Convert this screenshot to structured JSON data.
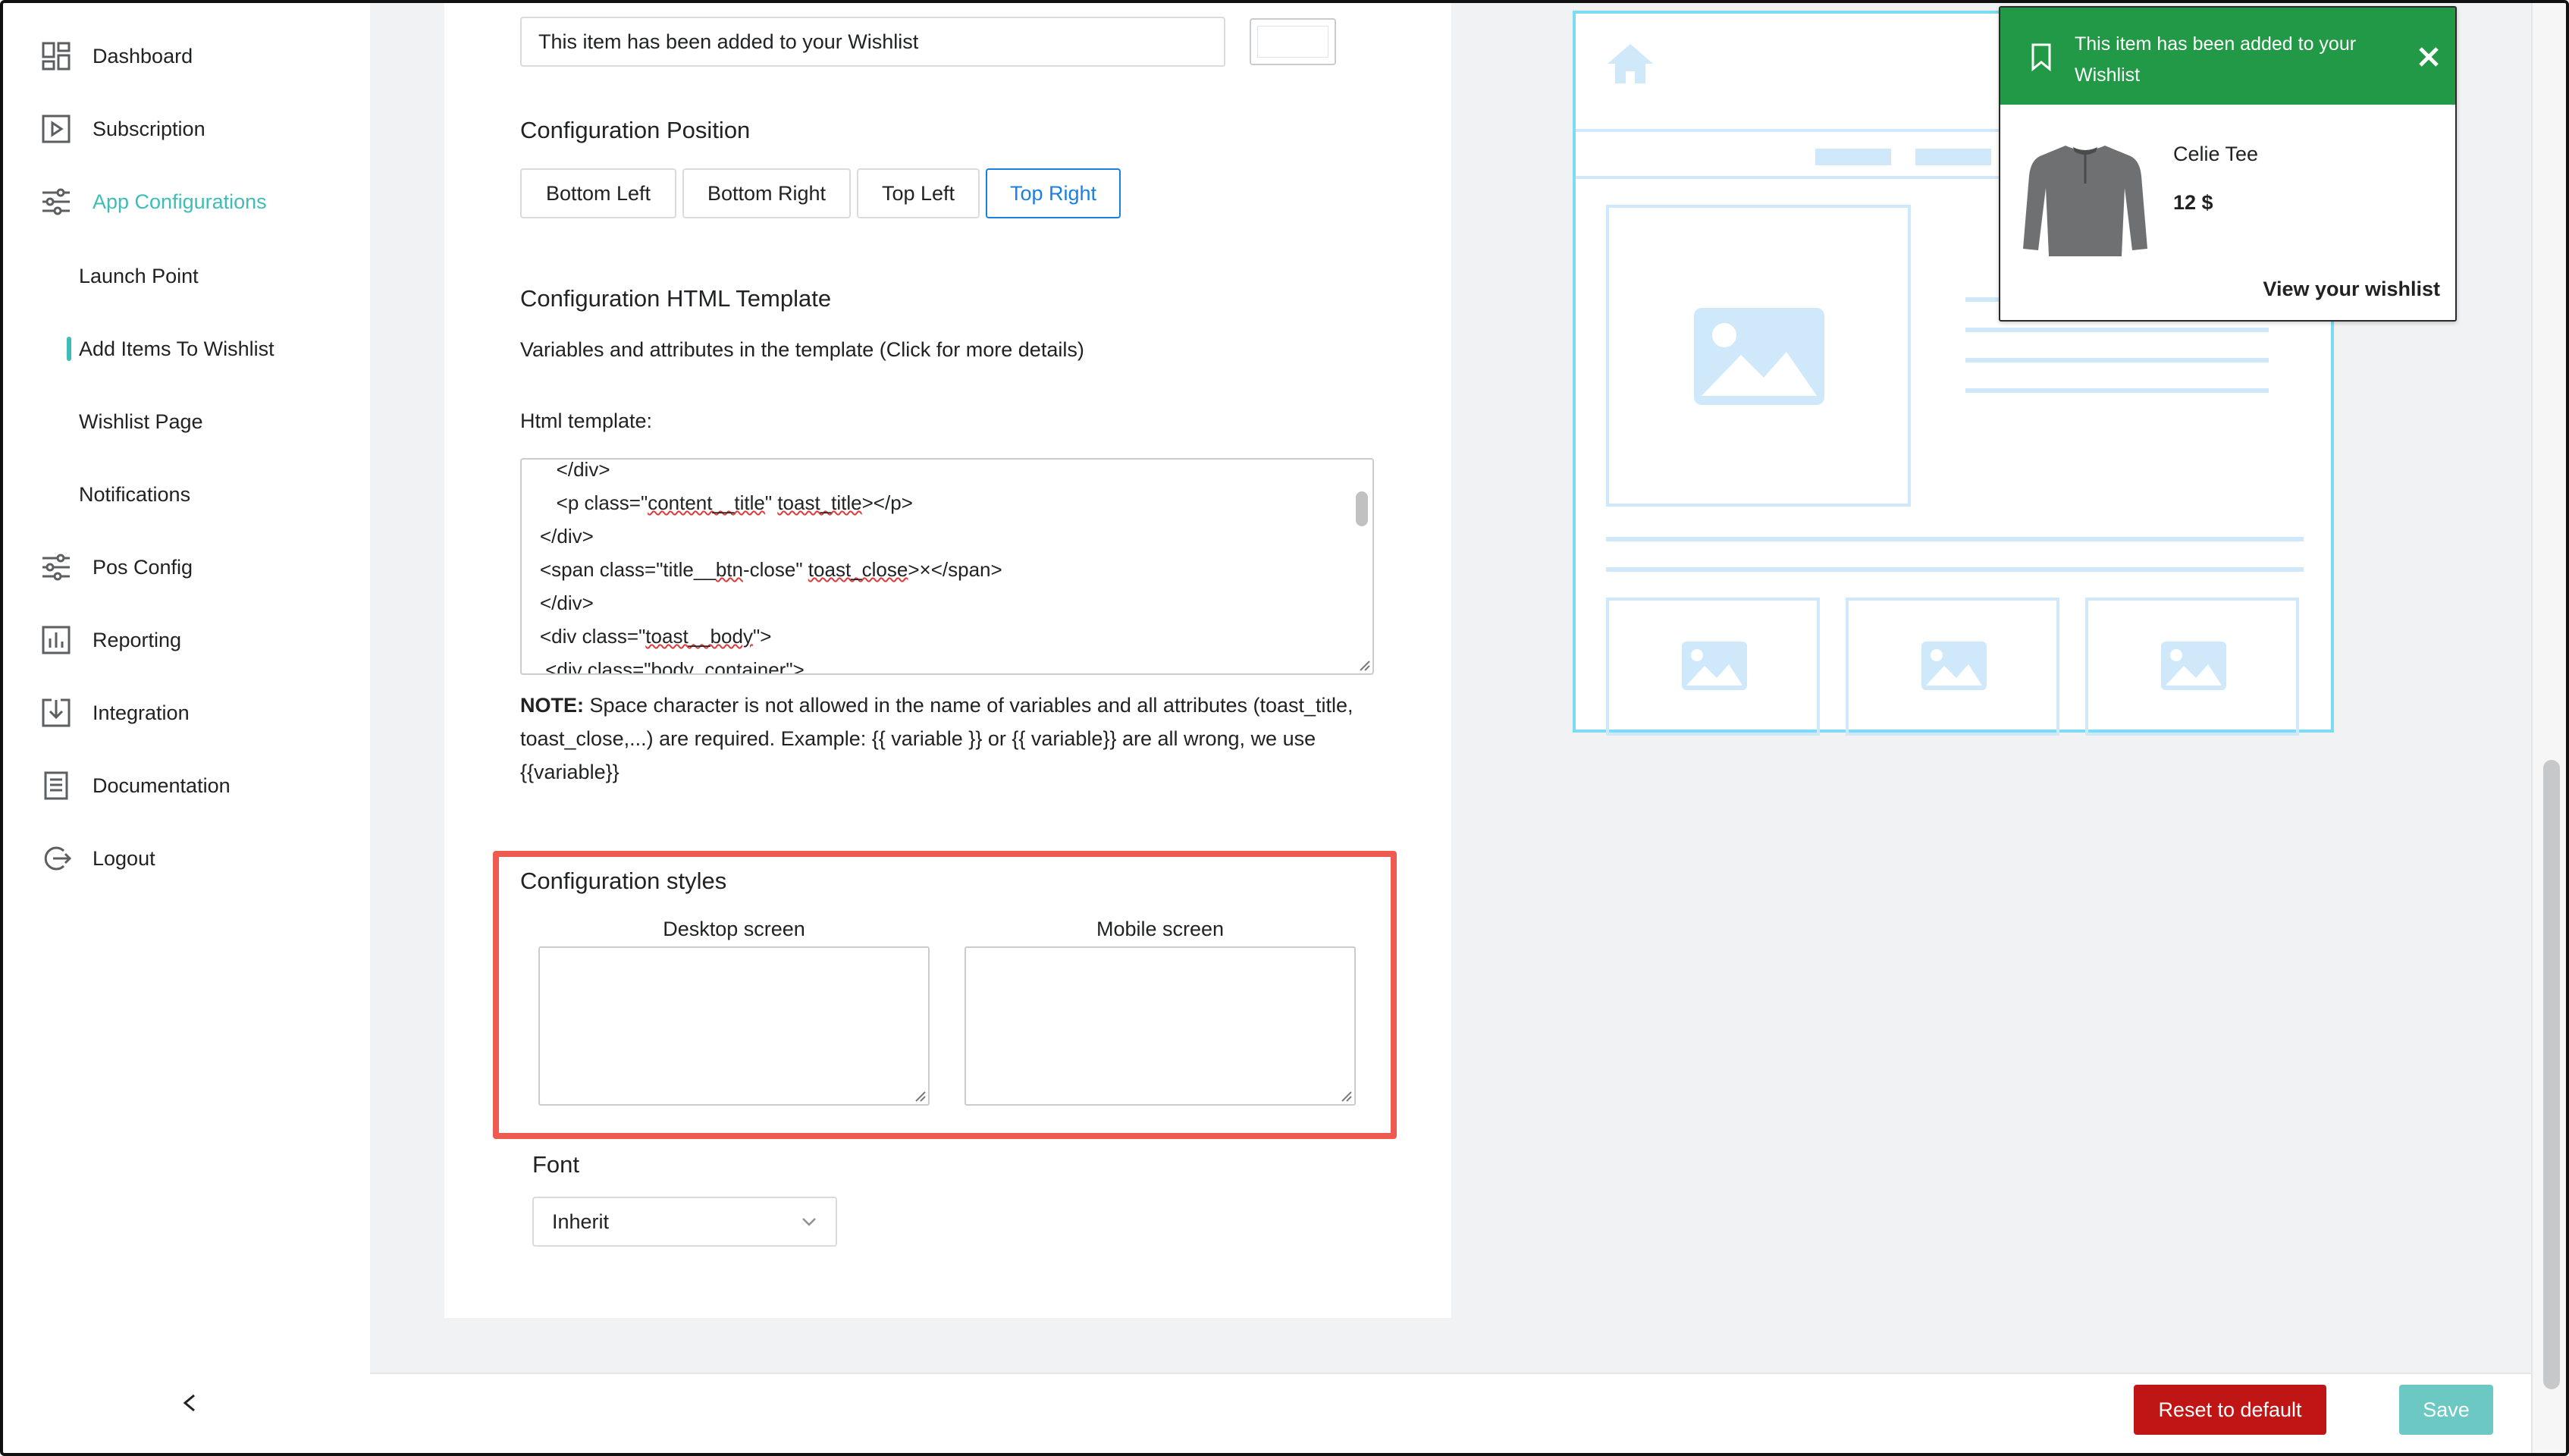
{
  "sidebar": {
    "items": [
      {
        "label": "Dashboard",
        "icon": "dashboard-icon"
      },
      {
        "label": "Subscription",
        "icon": "play-square-icon"
      },
      {
        "label": "App Configurations",
        "icon": "sliders-icon"
      },
      {
        "label": "Pos Config",
        "icon": "sliders-icon"
      },
      {
        "label": "Reporting",
        "icon": "bar-chart-icon"
      },
      {
        "label": "Integration",
        "icon": "download-box-icon"
      },
      {
        "label": "Documentation",
        "icon": "document-icon"
      },
      {
        "label": "Logout",
        "icon": "logout-icon"
      }
    ],
    "sub_items": [
      {
        "label": "Launch Point"
      },
      {
        "label": "Add Items To Wishlist"
      },
      {
        "label": "Wishlist Page"
      },
      {
        "label": "Notifications"
      }
    ],
    "collapse_glyph": "<"
  },
  "form": {
    "message_value": "This item has been added to your Wishlist",
    "position": {
      "title": "Configuration Position",
      "options": [
        "Bottom Left",
        "Bottom Right",
        "Top Left",
        "Top Right"
      ],
      "selected": "Top Right"
    },
    "template": {
      "title": "Configuration HTML Template",
      "description": "Variables and attributes in the template (Click for more details)",
      "field_label": "Html template:",
      "note_bold": "NOTE:",
      "note_text": " Space character is not allowed in the name of variables and all attributes (toast_title, toast_close,...) are required. Example: {{ variable }} or {{ variable}} are all wrong, we use {{variable}}"
    },
    "styles": {
      "title": "Configuration styles",
      "desktop_label": "Desktop screen",
      "mobile_label": "Mobile screen"
    },
    "font": {
      "label": "Font",
      "value": "Inherit"
    }
  },
  "preview": {
    "toast_title": "This item has been added to your Wishlist",
    "product_name": "Celie Tee",
    "product_price": "12 $",
    "link_text": "View your wishlist"
  },
  "footer": {
    "reset_label": "Reset to default",
    "save_label": "Save"
  },
  "colors": {
    "accent": "#3dbdb6",
    "toast_green": "#229946",
    "reset_red": "#bf1515",
    "highlight": "#ef5b51",
    "selected_blue": "#1a7fe0"
  }
}
